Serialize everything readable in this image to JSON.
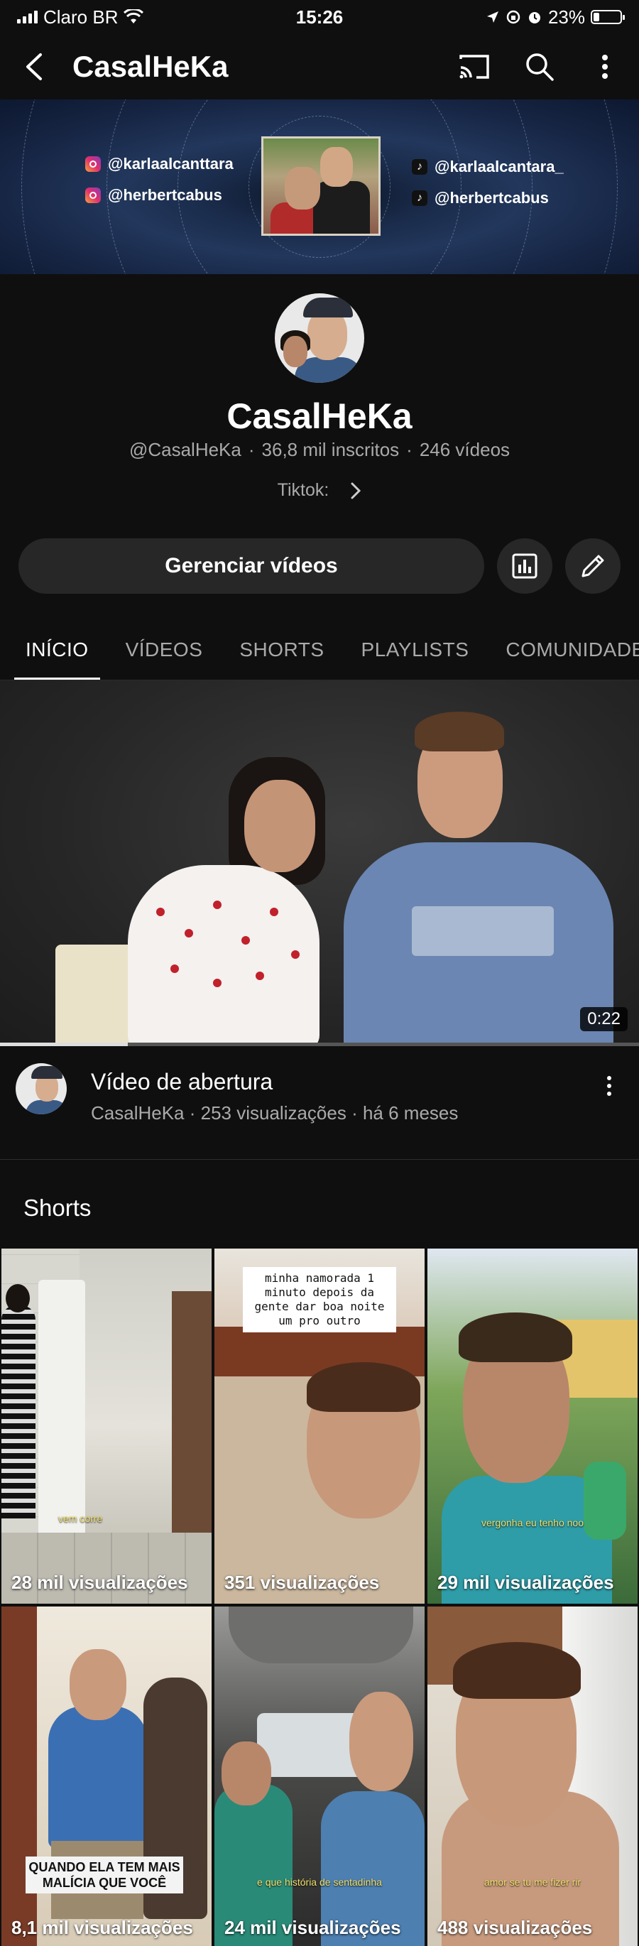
{
  "status_bar": {
    "carrier": "Claro BR",
    "time": "15:26",
    "battery": "23%",
    "battery_level": 0.23
  },
  "app_bar": {
    "title": "CasalHeKa",
    "icons": [
      "back-arrow-icon",
      "cast-icon",
      "search-icon",
      "more-vert-icon"
    ]
  },
  "banner": {
    "instagram": [
      "@karlaalcanttara",
      "@herbertcabus"
    ],
    "tiktok": [
      "@karlaalcantara_",
      "@herbertcabus"
    ]
  },
  "channel": {
    "name": "CasalHeKa",
    "handle": "@CasalHeKa",
    "subscribers": "36,8 mil inscritos",
    "videos": "246 vídeos",
    "link_label": "Tiktok:"
  },
  "actions": {
    "manage_label": "Gerenciar vídeos",
    "icons": [
      "analytics-icon",
      "edit-pencil-icon"
    ]
  },
  "tabs": [
    {
      "label": "INÍCIO",
      "active": true
    },
    {
      "label": "VÍDEOS",
      "active": false
    },
    {
      "label": "SHORTS",
      "active": false
    },
    {
      "label": "PLAYLISTS",
      "active": false
    },
    {
      "label": "COMUNIDADE",
      "active": false
    }
  ],
  "featured_video": {
    "duration": "0:22",
    "progress": 0.2,
    "title": "Vídeo de abertura",
    "subtitle": "CasalHeKa · 253 visualizações · há 6 meses"
  },
  "shorts": {
    "title": "Shorts",
    "items": [
      {
        "views": "28 mil visualizações",
        "caption": "vem corre"
      },
      {
        "views": "351 visualizações",
        "caption": "minha namorada 1 minuto depois da gente dar boa noite um pro outro"
      },
      {
        "views": "29 mil visualizações",
        "caption": "vergonha eu tenho noo"
      },
      {
        "views": "8,1 mil visualizações",
        "caption": "QUANDO ELA TEM MAIS MALÍCIA QUE VOCÊ"
      },
      {
        "views": "24 mil visualizações",
        "caption": "e que história de sentadinha"
      },
      {
        "views": "488 visualizações",
        "caption": "amor se tu me fizer rir"
      }
    ]
  }
}
